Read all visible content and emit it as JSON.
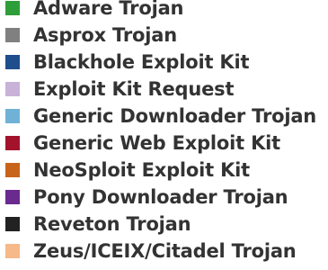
{
  "chart_data": {
    "type": "legend",
    "legend_entries": [
      {
        "label": "Adware Trojan",
        "color": "#2e9e3a"
      },
      {
        "label": "Asprox Trojan",
        "color": "#808080"
      },
      {
        "label": "Blackhole Exploit Kit",
        "color": "#1f4e8c"
      },
      {
        "label": "Exploit Kit Request",
        "color": "#c8b2d8"
      },
      {
        "label": "Generic Downloader Trojan",
        "color": "#6fb2d6"
      },
      {
        "label": "Generic Web Exploit Kit",
        "color": "#a3132b"
      },
      {
        "label": "NeoSploit Exploit Kit",
        "color": "#c8641a"
      },
      {
        "label": "Pony Downloader Trojan",
        "color": "#6a2a8e"
      },
      {
        "label": "Reveton Trojan",
        "color": "#222222"
      },
      {
        "label": "Zeus/ICEIX/Citadel Trojan",
        "color": "#f6b98a"
      }
    ]
  }
}
